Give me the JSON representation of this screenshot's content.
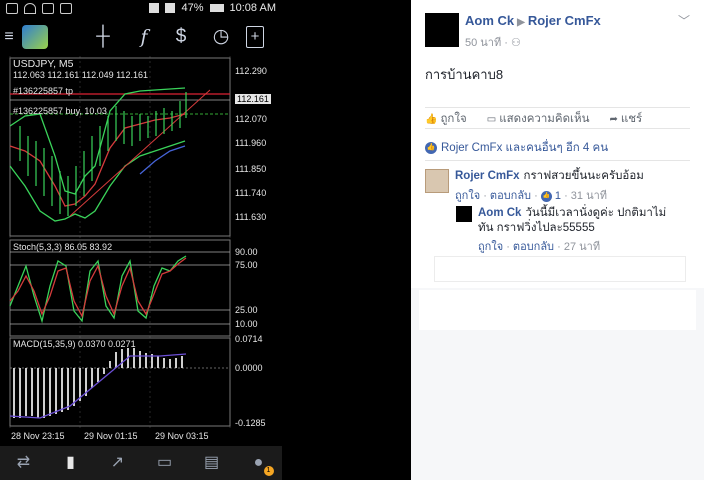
{
  "status": {
    "battery": "47%",
    "time": "10:08 AM"
  },
  "chart": {
    "symbol": "USDJPY, M5",
    "ohlc": "112.063 112.161 112.049 112.161",
    "tp_label": "#136225857 tp",
    "buy_label": "#136225857 buy, 10.03",
    "price_axis": [
      "112.290",
      "112.161",
      "112.070",
      "111.960",
      "111.850",
      "111.740",
      "111.630"
    ],
    "stoch_label": "Stoch(5,3,3) 86.05 83.92",
    "stoch_axis": [
      "90.00",
      "75.00",
      "25.00",
      "10.00"
    ],
    "macd_label": "MACD(15,35,9) 0.0370 0.0271",
    "macd_axis": [
      "0.0714",
      "0.0000",
      "-0.1285"
    ],
    "time_axis": [
      "28 Nov 23:15",
      "29 Nov 01:15",
      "29 Nov 03:15"
    ]
  },
  "toolbar": {
    "menu": "≡",
    "crosshair": "┼",
    "indicators": "f",
    "objects": "$",
    "clock": "◷",
    "new": "+"
  },
  "bottom_nav": {
    "quotes": "⇄",
    "chart": "▮",
    "trade": "↗",
    "history": "▭",
    "news": "▤",
    "chat_badge": "1"
  },
  "post": {
    "author": "Aom Ck",
    "target": "Rojer CmFx",
    "time": "50 นาที",
    "text": "การบ้านคาบ8",
    "like": "ถูกใจ",
    "comment": "แสดงความคิดเห็น",
    "share": "แชร์",
    "likes_summary": "Rojer CmFx และคนอื่นๆ อีก 4 คน"
  },
  "comments": [
    {
      "author": "Rojer CmFx",
      "text": "กราฟสวยขึ้นนะครับอ้อม",
      "like": "ถูกใจ",
      "reply": "ตอบกลับ",
      "like_count": "1",
      "time": "31 นาที"
    },
    {
      "author": "Aom Ck",
      "text_line1": "วันนี้มีเวลานั่งดูค่ะ ปกติมาไม่",
      "text_line2": "ทัน กราฟวิ่งไปละ55555",
      "like": "ถูกใจ",
      "reply": "ตอบกลับ",
      "time": "27 นาที"
    }
  ]
}
